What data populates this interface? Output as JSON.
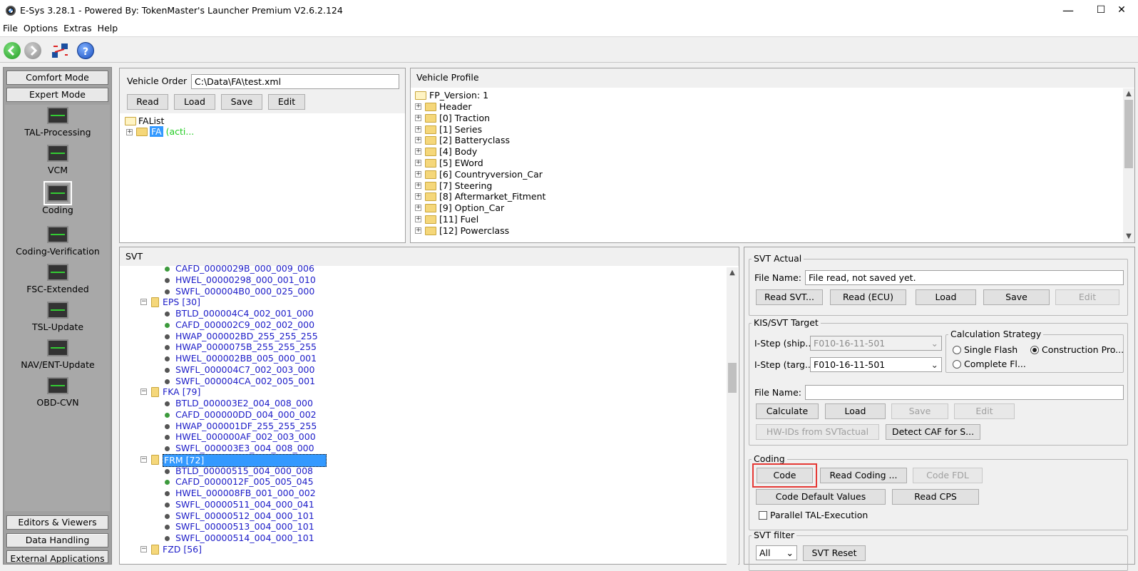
{
  "window": {
    "title": "E-Sys 3.28.1 - Powered By: TokenMaster's Launcher Premium V2.6.2.124",
    "minimize": "—",
    "maximize": "☐",
    "close": "✕"
  },
  "menu": [
    "File",
    "Options",
    "Extras",
    "Help"
  ],
  "nav": {
    "modes": [
      "Comfort Mode",
      "Expert Mode"
    ],
    "items": [
      "TAL-Processing",
      "VCM",
      "Coding",
      "Coding-Verification",
      "FSC-Extended",
      "TSL-Update",
      "NAV/ENT-Update",
      "OBD-CVN"
    ],
    "selected": "Coding",
    "bottom": [
      "Editors & Viewers",
      "Data Handling",
      "External Applications"
    ]
  },
  "vehicle_order": {
    "label": "Vehicle Order",
    "path": "C:\\Data\\FA\\test.xml",
    "buttons": [
      "Read",
      "Load",
      "Save",
      "Edit"
    ],
    "tree_root": "FAList",
    "tree_child": "FA",
    "tree_child_suffix": "(acti..."
  },
  "vehicle_profile": {
    "title": "Vehicle Profile",
    "root": "FP_Version: 1",
    "items": [
      "Header",
      "[0] Traction",
      "[1] Series",
      "[2] Batteryclass",
      "[4] Body",
      "[5] EWord",
      "[6] Countryversion_Car",
      "[7] Steering",
      "[8] Aftermarket_Fitment",
      "[9] Option_Car",
      "[11] Fuel",
      "[12] Powerclass"
    ]
  },
  "svt": {
    "title": "SVT",
    "rows": [
      {
        "type": "leaf",
        "text": "CAFD_0000029B_000_009_006",
        "green": true
      },
      {
        "type": "leaf",
        "text": "HWEL_00000298_000_001_010",
        "green": false
      },
      {
        "type": "leaf",
        "text": "SWFL_000004B0_000_025_000",
        "green": false
      },
      {
        "type": "group",
        "text": "EPS [30]",
        "selected": false
      },
      {
        "type": "leaf",
        "text": "BTLD_000004C4_002_001_000",
        "green": false
      },
      {
        "type": "leaf",
        "text": "CAFD_000002C9_002_002_000",
        "green": true
      },
      {
        "type": "leaf",
        "text": "HWAP_000002BD_255_255_255",
        "green": false
      },
      {
        "type": "leaf",
        "text": "HWAP_0000075B_255_255_255",
        "green": false
      },
      {
        "type": "leaf",
        "text": "HWEL_000002BB_005_000_001",
        "green": false
      },
      {
        "type": "leaf",
        "text": "SWFL_000004C7_002_003_000",
        "green": false
      },
      {
        "type": "leaf",
        "text": "SWFL_000004CA_002_005_001",
        "green": false
      },
      {
        "type": "group",
        "text": "FKA [79]",
        "selected": false
      },
      {
        "type": "leaf",
        "text": "BTLD_000003E2_004_008_000",
        "green": false
      },
      {
        "type": "leaf",
        "text": "CAFD_000000DD_004_000_002",
        "green": true
      },
      {
        "type": "leaf",
        "text": "HWAP_000001DF_255_255_255",
        "green": false
      },
      {
        "type": "leaf",
        "text": "HWEL_000000AF_002_003_000",
        "green": false
      },
      {
        "type": "leaf",
        "text": "SWFL_000003E3_004_008_000",
        "green": false
      },
      {
        "type": "group",
        "text": "FRM [72]",
        "selected": true
      },
      {
        "type": "leaf",
        "text": "BTLD_00000515_004_000_008",
        "green": false
      },
      {
        "type": "leaf",
        "text": "CAFD_0000012F_005_005_045",
        "green": true
      },
      {
        "type": "leaf",
        "text": "HWEL_000008FB_001_000_002",
        "green": false
      },
      {
        "type": "leaf",
        "text": "SWFL_00000511_004_000_041",
        "green": false
      },
      {
        "type": "leaf",
        "text": "SWFL_00000512_004_000_101",
        "green": false
      },
      {
        "type": "leaf",
        "text": "SWFL_00000513_004_000_101",
        "green": false
      },
      {
        "type": "leaf",
        "text": "SWFL_00000514_004_000_101",
        "green": false
      },
      {
        "type": "group",
        "text": "FZD [56]",
        "selected": false
      }
    ]
  },
  "svt_actual": {
    "title": "SVT Actual",
    "file_label": "File Name:",
    "file_value": "File read, not saved yet.",
    "buttons": [
      "Read SVT...",
      "Read (ECU)",
      "Load",
      "Save",
      "Edit"
    ]
  },
  "kis": {
    "title": "KIS/SVT Target",
    "istep_ship_label": "I-Step (ship...",
    "istep_ship_value": "F010-16-11-501",
    "istep_target_label": "I-Step (targ...",
    "istep_target_value": "F010-16-11-501",
    "calc_title": "Calculation Strategy",
    "opt_single": "Single Flash",
    "opt_construction": "Construction Pro...",
    "opt_complete": "Complete Fl...",
    "file_label": "File Name:",
    "file_value": "",
    "buttons": [
      "Calculate",
      "Load",
      "Save",
      "Edit"
    ],
    "hw_ids": "HW-IDs from SVTactual",
    "detect_caf": "Detect CAF for S..."
  },
  "coding": {
    "title": "Coding",
    "code": "Code",
    "read_coding": "Read Coding ...",
    "code_fdl": "Code FDL",
    "code_default": "Code Default Values",
    "read_cps": "Read CPS",
    "parallel": "Parallel TAL-Execution"
  },
  "svt_filter": {
    "title": "SVT filter",
    "select": "All",
    "reset": "SVT Reset"
  },
  "colors": {
    "selection": "#3399ff",
    "link_blue": "#1c1cc8",
    "highlight_red": "#e53935",
    "acti_green": "#22cc22"
  }
}
